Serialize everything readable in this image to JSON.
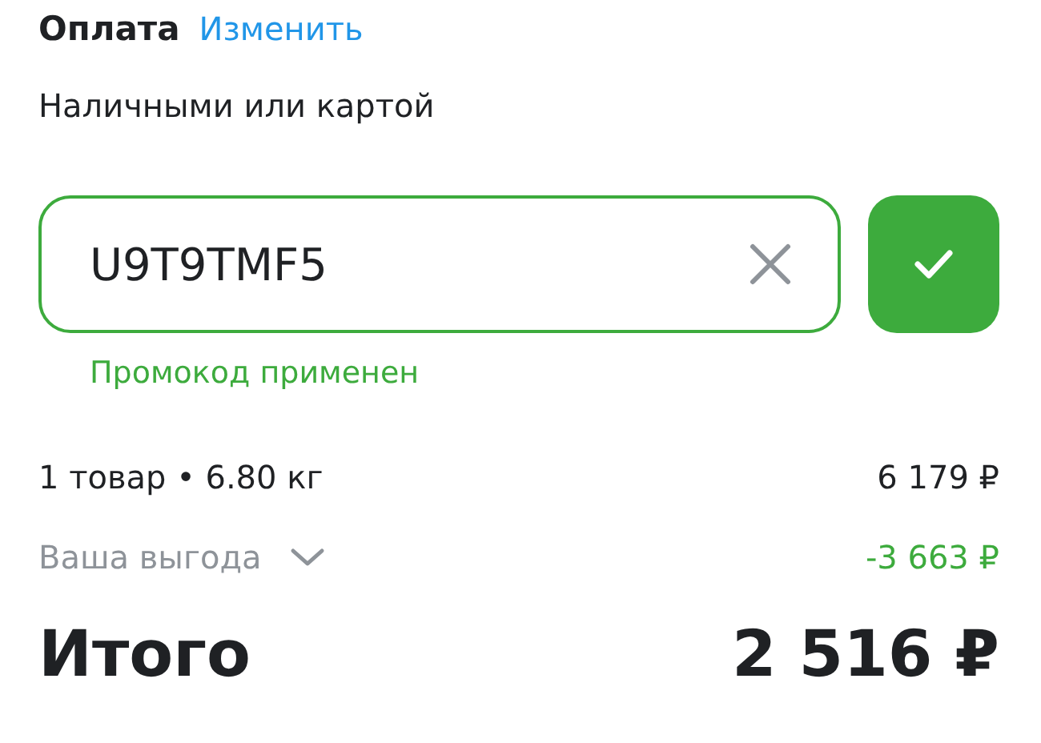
{
  "payment": {
    "title": "Оплата",
    "change_link": "Изменить",
    "method": "Наличными или картой"
  },
  "promo": {
    "value": "U9T9TMF5",
    "applied": true,
    "status": "Промокод применен"
  },
  "summary": {
    "items_label": "1 товар • 6.80 кг",
    "items_price": "6 179 ₽",
    "savings_label": "Ваша выгода",
    "savings_expanded": false,
    "savings_value": "-3 663 ₽",
    "total_label": "Итого",
    "total_value": "2 516 ₽"
  }
}
